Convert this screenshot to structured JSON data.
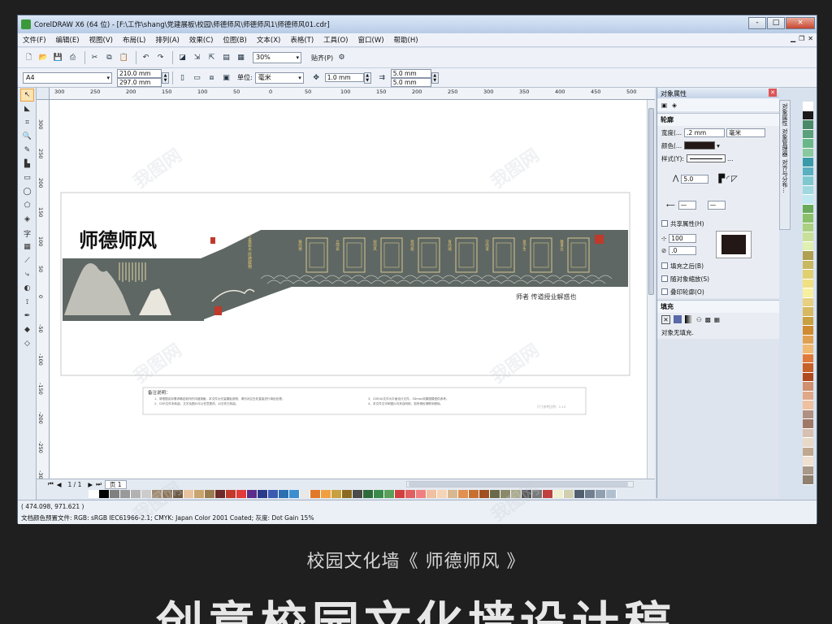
{
  "window": {
    "title": "CorelDRAW X6 (64 位) - [F:\\工作\\shang\\党建展板\\校园\\师德师风\\师德师风1\\师德师风01.cdr]",
    "controls": [
      "-",
      "□",
      "×"
    ]
  },
  "menu": [
    "文件(F)",
    "编辑(E)",
    "视图(V)",
    "布局(L)",
    "排列(A)",
    "效果(C)",
    "位图(B)",
    "文本(X)",
    "表格(T)",
    "工具(O)",
    "窗口(W)",
    "帮助(H)"
  ],
  "toolbar": {
    "zoom": "30%",
    "snap": "贴齐(P)"
  },
  "propertybar": {
    "page_size": "A4",
    "width": "210.0 mm",
    "height": "297.0 mm",
    "units_label": "单位:",
    "units": "毫米",
    "nudge": "1.0 mm",
    "dup_x": "5.0 mm",
    "dup_y": "5.0 mm"
  },
  "rulers": {
    "h_labels": [
      "300",
      "250",
      "200",
      "150",
      "100",
      "50",
      "0",
      "50",
      "100",
      "150",
      "200",
      "250",
      "300",
      "350",
      "400",
      "450",
      "500"
    ],
    "v_labels": [
      "300",
      "250",
      "200",
      "150",
      "100",
      "50",
      "0",
      "-50",
      "-100",
      "-150",
      "-200",
      "-250",
      "-300"
    ]
  },
  "artwork": {
    "title": "师德师风",
    "slogan_small": "上善若水 厚德载物",
    "slogan_right": "师者  传道授业解惑也",
    "panels": [
      "铸师德",
      "立师表",
      "树师风",
      "修师能",
      "育师魂",
      "守师道",
      "爱学生",
      "敬事业"
    ],
    "notes_title": "备注说明：",
    "notes_lines": [
      "1、请根据实际需求确定制作的详细规格，本文件为矢量模板参照，请勿对空白处直接进行填色处理。",
      "2、CDR文件未转曲，文字及图片可以任意更改，AI文件已转曲。",
      "3、CDR/AI文件为平面设计文件，3Dmax效果图模型供参考。",
      "4、本文件文字和图片均来自网络，若有侵权请联系删除。"
    ],
    "notes_footer": "尺寸参考比例：1:10"
  },
  "bottombar": {
    "page_counter": "1 / 1",
    "page_tab": "页 1"
  },
  "status": {
    "coords": "( 474.098, 971.621 )",
    "color_profile": "文档颜色预置文件: RGB: sRGB IEC61966-2.1; CMYK: Japan Color 2001 Coated; 灰度: Dot Gain 15%"
  },
  "docker": {
    "title": "对象属性",
    "outline_section": "轮廓",
    "width_label": "宽度(...",
    "width_value": ".2 mm",
    "width_unit": "毫米",
    "color_label": "颜色(...",
    "style_label": "样式(Y):",
    "miter_value": "5.0",
    "shared_attr": "共享属性(H)",
    "stretch_value": "100",
    "angle_value": ".0",
    "fill_behind": "填充之后(B)",
    "scale_with": "随对象缩放(S)",
    "overprint": "叠印轮廓(O)",
    "fill_section": "填充",
    "no_fill": "对象无填充."
  },
  "side_tabs": [
    "对象属性",
    "对象管理器",
    "对齐与分布..."
  ],
  "caption": "校园文化墙《 师德师风 》",
  "headline": "创意校园文化墙设计稿",
  "watermark": "我图网",
  "palette_h": [
    "#ffffff",
    "#000000",
    "#7f7f7f",
    "#999999",
    "#b2b2b2",
    "#cccccc",
    "#a08a6f",
    "#8b7355",
    "#6d5a44",
    "#e8c39e",
    "#c8a46e",
    "#9a7b4f",
    "#6e2a2a",
    "#c0392b",
    "#e03a3a",
    "#5b2d8a",
    "#2a3a8a",
    "#3a5bb0",
    "#2a6fb0",
    "#3a8fd0",
    "#e8e8e8",
    "#e07a2a",
    "#f0a040",
    "#c8a040",
    "#8a6a20",
    "#4a4a4a",
    "#2e6b3a",
    "#3a8a4a",
    "#5aa05a",
    "#d04040",
    "#e06060",
    "#f08080",
    "#f0c0a0",
    "#f5d5b5",
    "#d8b890",
    "#e09050",
    "#c87030",
    "#a05020",
    "#6a6a4a",
    "#8a8a6a",
    "#aaaa8a",
    "#555555",
    "#777777",
    "#c04040",
    "#f0f0d0",
    "#d0d0b0",
    "#506070",
    "#708090",
    "#90a0b0",
    "#b0c0d0"
  ],
  "palette_v": [
    "#ffffff",
    "#1a1a1a",
    "#4a8a6a",
    "#5aa07a",
    "#6ab88a",
    "#8ac8a0",
    "#3a9aaa",
    "#5ab0c0",
    "#80c8d0",
    "#a0d8e0",
    "#c0e8f0",
    "#6aaa5a",
    "#8ac06a",
    "#aad080",
    "#c8e098",
    "#e0f0b0",
    "#b0a050",
    "#c8b860",
    "#e0d070",
    "#f0e080",
    "#f8f0a0",
    "#e8d080",
    "#d8b860",
    "#c8a040",
    "#d08a30",
    "#e0a050",
    "#f0b870",
    "#e07a3a",
    "#c8602a",
    "#b04820",
    "#d09070",
    "#e0a888",
    "#f0c0a0",
    "#b09080",
    "#a07868",
    "#d8c0b0",
    "#e8d8c8",
    "#c0a890",
    "#f0e0d0",
    "#a89888",
    "#908070"
  ]
}
